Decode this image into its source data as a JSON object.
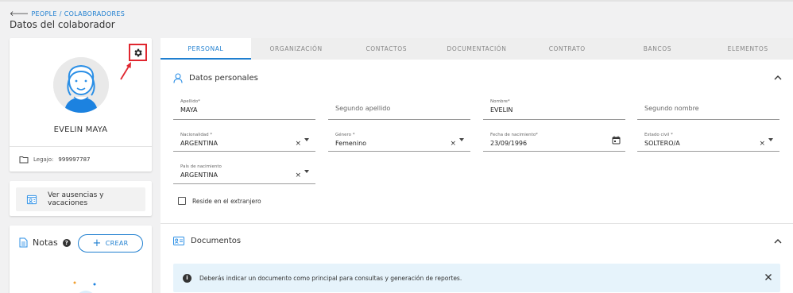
{
  "breadcrumb": {
    "back_arrow": "🡐",
    "root": "PEOPLE",
    "separator": "/",
    "current": "COLABORADORES"
  },
  "page_title": "Datos del colaborador",
  "profile": {
    "name": "EVELIN MAYA",
    "legajo_label": "Legajo:",
    "legajo_value": "999997787",
    "settings_icon": "gear-icon",
    "highlight_color": "#e0262f"
  },
  "absence_button": {
    "label": "Ver ausencias y vacaciones"
  },
  "notes": {
    "title": "Notas",
    "help": "?",
    "create_label": "CREAR",
    "create_icon": "+"
  },
  "tabs": [
    {
      "label": "PERSONAL",
      "active": true
    },
    {
      "label": "ORGANIZACIÓN",
      "active": false
    },
    {
      "label": "CONTACTOS",
      "active": false
    },
    {
      "label": "DOCUMENTACIÓN",
      "active": false
    },
    {
      "label": "CONTRATO",
      "active": false
    },
    {
      "label": "BANCOS",
      "active": false
    },
    {
      "label": "ELEMENTOS",
      "active": false
    }
  ],
  "personal_section": {
    "title": "Datos personales",
    "fields": {
      "apellido": {
        "label": "Apellido*",
        "value": "MAYA"
      },
      "segundo_apellido": {
        "placeholder": "Segundo apellido"
      },
      "nombre": {
        "label": "Nombre*",
        "value": "EVELIN"
      },
      "segundo_nombre": {
        "placeholder": "Segundo nombre"
      },
      "nacionalidad": {
        "label": "Nacionalidad *",
        "value": "ARGENTINA"
      },
      "genero": {
        "label": "Género *",
        "value": "Femenino"
      },
      "fecha_nacimiento": {
        "label": "Fecha de nacimiento*",
        "value": "23/09/1996"
      },
      "estado_civil": {
        "label": "Estado civil *",
        "value": "SOLTERO/A"
      },
      "pais_nacimiento": {
        "label": "País de nacimiento",
        "value": "ARGENTINA"
      }
    },
    "reside_extranjero": {
      "label": "Reside en el extranjero",
      "checked": false
    },
    "clear_glyph": "×"
  },
  "documentos_section": {
    "title": "Documentos",
    "info_text": "Deberás indicar un documento como principal para consultas y generación de reportes.",
    "info_glyph": "i"
  },
  "colors": {
    "accent": "#1f7fd0",
    "banner_bg": "#e6f3fb"
  }
}
